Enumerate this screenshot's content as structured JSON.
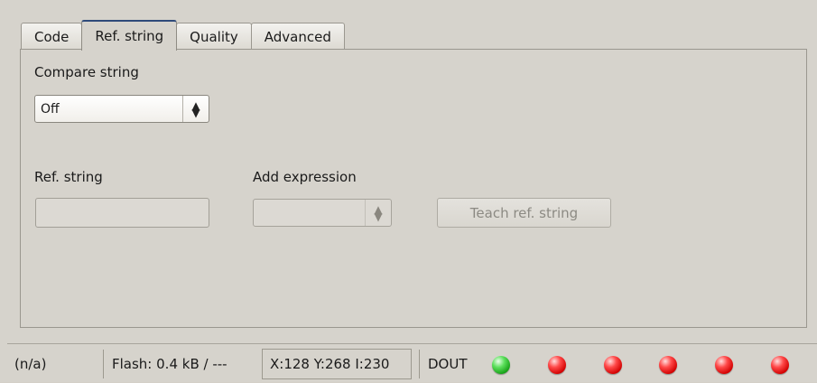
{
  "tabs": [
    {
      "label": "Code"
    },
    {
      "label": "Ref. string"
    },
    {
      "label": "Quality"
    },
    {
      "label": "Advanced"
    }
  ],
  "active_tab": "Ref. string",
  "panel": {
    "compare_label": "Compare string",
    "compare_value": "Off",
    "refstring_label": "Ref. string",
    "refstring_value": "",
    "add_expression_label": "Add expression",
    "add_expression_value": "",
    "teach_button_label": "Teach ref. string"
  },
  "status": {
    "na": "(n/a)",
    "flash": "Flash:  0.4 kB / ---",
    "coords": "X:128 Y:268 I:230",
    "dout_label": "DOUT",
    "leds": [
      {
        "state": "on",
        "color": "#2fc92f"
      },
      {
        "state": "off",
        "color": "#e00000"
      },
      {
        "state": "off",
        "color": "#e00000"
      },
      {
        "state": "off",
        "color": "#e00000"
      },
      {
        "state": "off",
        "color": "#e00000"
      },
      {
        "state": "off",
        "color": "#e00000"
      }
    ]
  },
  "icons": {
    "select_arrow": "up-down-arrows-icon",
    "led": "status-led-icon"
  }
}
